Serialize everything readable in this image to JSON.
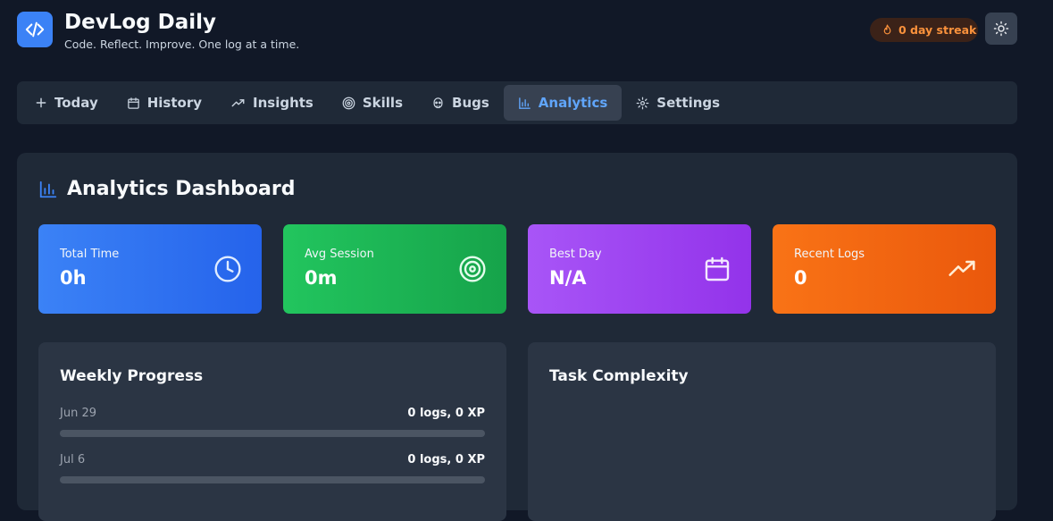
{
  "header": {
    "title": "DevLog Daily",
    "tagline": "Code. Reflect. Improve. One log at a time.",
    "streak": "0 day streak"
  },
  "nav": {
    "tabs": [
      {
        "label": "Today",
        "icon": "plus-icon"
      },
      {
        "label": "History",
        "icon": "calendar-icon"
      },
      {
        "label": "Insights",
        "icon": "trending-icon"
      },
      {
        "label": "Skills",
        "icon": "target-icon"
      },
      {
        "label": "Bugs",
        "icon": "bug-icon"
      },
      {
        "label": "Analytics",
        "icon": "bar-chart-icon",
        "active": true
      },
      {
        "label": "Settings",
        "icon": "gear-icon"
      }
    ]
  },
  "dashboard": {
    "title": "Analytics Dashboard",
    "stats": [
      {
        "label": "Total Time",
        "value": "0h",
        "icon": "clock-icon"
      },
      {
        "label": "Avg Session",
        "value": "0m",
        "icon": "target-icon"
      },
      {
        "label": "Best Day",
        "value": "N/A",
        "icon": "calendar-icon"
      },
      {
        "label": "Recent Logs",
        "value": "0",
        "icon": "trending-up-icon"
      }
    ],
    "weekly": {
      "title": "Weekly Progress",
      "rows": [
        {
          "date": "Jun 29",
          "stats": "0 logs, 0 XP",
          "progress": 0
        },
        {
          "date": "Jul 6",
          "stats": "0 logs, 0 XP",
          "progress": 0
        }
      ]
    },
    "complexity": {
      "title": "Task Complexity"
    }
  },
  "colors": {
    "background": "#111827",
    "surface": "#1f2937",
    "accent": "#3b82f6",
    "streak": "#fb923c"
  }
}
